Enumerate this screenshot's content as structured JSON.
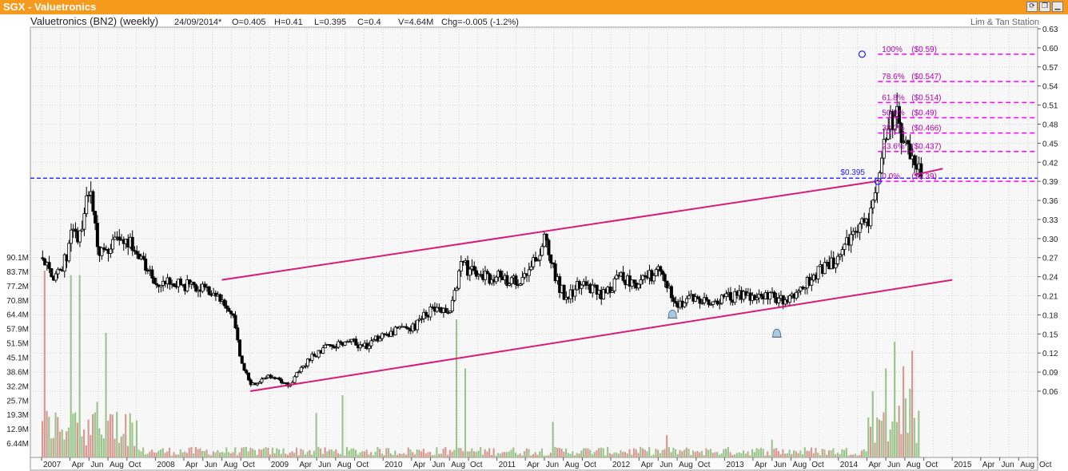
{
  "window": {
    "title": "SGX - Valuetronics",
    "buttons": [
      {
        "name": "refresh-button",
        "glyph": "⟳"
      },
      {
        "name": "restore-button",
        "glyph": "❐"
      },
      {
        "name": "minimize-button",
        "glyph": "▁"
      },
      {
        "name": "close-button",
        "glyph": "■"
      }
    ]
  },
  "header": {
    "name": "Valuetronics (BN2) (weekly)",
    "date": "24/09/2014*",
    "open": "O=0.405",
    "high": "H=0.41",
    "low": "L=0.395",
    "close": "C=0.4",
    "volume": "V=4.64M",
    "change": "Chg=-0.005 (-1.2%)",
    "source": "Lim & Tan Station"
  },
  "colors": {
    "title_bar": "#f59a1c",
    "trendline": "#d81b7a",
    "fib": "#ff00ff",
    "support_line": "#2222ee",
    "volume_up": "#9bc48a",
    "volume_down": "#d49a92",
    "grid": "#d4d4d4",
    "plot_bg": "#f7f7f7"
  },
  "chart_data": {
    "type": "candlestick",
    "title": "Valuetronics (BN2) (weekly)",
    "price_axis": {
      "side": "right",
      "ylim": [
        0.03,
        0.63
      ],
      "ticks": [
        "0.63",
        "0.60",
        "0.57",
        "0.54",
        "0.51",
        "0.48",
        "0.45",
        "0.42",
        "0.39",
        "0.36",
        "0.33",
        "0.30",
        "0.27",
        "0.24",
        "0.21",
        "0.18",
        "0.15",
        "0.12",
        "0.09",
        "0.06"
      ]
    },
    "volume_axis": {
      "side": "left",
      "ticks": [
        "90.1M",
        "83.7M",
        "77.2M",
        "70.8M",
        "64.4M",
        "57.9M",
        "51.5M",
        "45.1M",
        "38.6M",
        "32.2M",
        "25.7M",
        "19.3M",
        "12.9M",
        "6.44M"
      ]
    },
    "time_axis": {
      "labels": [
        "2007",
        "Apr",
        "Jun",
        "Aug",
        "Oct",
        "2008",
        "Apr",
        "Jun",
        "Aug",
        "Oct",
        "2009",
        "Apr",
        "Jun",
        "Aug",
        "Oct",
        "2010",
        "Apr",
        "Jun",
        "Aug",
        "Oct",
        "2011",
        "Apr",
        "Jun",
        "Aug",
        "Oct",
        "2012",
        "Apr",
        "Jun",
        "Aug",
        "Oct",
        "2013",
        "Apr",
        "Jun",
        "Aug",
        "Oct",
        "2014",
        "Apr",
        "Jun",
        "Aug",
        "Oct",
        "2015",
        "Apr",
        "Jun",
        "Aug",
        "Oct"
      ],
      "start": "2007-01",
      "end": "2015-10"
    },
    "price_path": [
      [
        "2007-01",
        0.27
      ],
      [
        "2007-02",
        0.24
      ],
      [
        "2007-03",
        0.25
      ],
      [
        "2007-04",
        0.3
      ],
      [
        "2007-05",
        0.31
      ],
      [
        "2007-06",
        0.38
      ],
      [
        "2007-07",
        0.27
      ],
      [
        "2007-08",
        0.29
      ],
      [
        "2007-09",
        0.3
      ],
      [
        "2007-10",
        0.3
      ],
      [
        "2007-11",
        0.27
      ],
      [
        "2007-12",
        0.25
      ],
      [
        "2008-01",
        0.23
      ],
      [
        "2008-03",
        0.23
      ],
      [
        "2008-06",
        0.22
      ],
      [
        "2008-08",
        0.2
      ],
      [
        "2008-09",
        0.18
      ],
      [
        "2008-10",
        0.1
      ],
      [
        "2008-11",
        0.07
      ],
      [
        "2009-01",
        0.085
      ],
      [
        "2009-03",
        0.07
      ],
      [
        "2009-05",
        0.11
      ],
      [
        "2009-07",
        0.13
      ],
      [
        "2009-09",
        0.14
      ],
      [
        "2009-11",
        0.13
      ],
      [
        "2010-01",
        0.15
      ],
      [
        "2010-04",
        0.16
      ],
      [
        "2010-06",
        0.19
      ],
      [
        "2010-08",
        0.18
      ],
      [
        "2010-09",
        0.26
      ],
      [
        "2010-11",
        0.24
      ],
      [
        "2011-01",
        0.24
      ],
      [
        "2011-03",
        0.23
      ],
      [
        "2011-05",
        0.27
      ],
      [
        "2011-06",
        0.3
      ],
      [
        "2011-07",
        0.24
      ],
      [
        "2011-08",
        0.21
      ],
      [
        "2011-10",
        0.23
      ],
      [
        "2011-12",
        0.21
      ],
      [
        "2012-02",
        0.24
      ],
      [
        "2012-04",
        0.23
      ],
      [
        "2012-06",
        0.25
      ],
      [
        "2012-07",
        0.22
      ],
      [
        "2012-08",
        0.2
      ],
      [
        "2012-10",
        0.205
      ],
      [
        "2012-12",
        0.2
      ],
      [
        "2013-02",
        0.21
      ],
      [
        "2013-05",
        0.21
      ],
      [
        "2013-07",
        0.205
      ],
      [
        "2013-09",
        0.22
      ],
      [
        "2013-11",
        0.25
      ],
      [
        "2014-01",
        0.27
      ],
      [
        "2014-02",
        0.3
      ],
      [
        "2014-04",
        0.33
      ],
      [
        "2014-05",
        0.4
      ],
      [
        "2014-06",
        0.48
      ],
      [
        "2014-07",
        0.5
      ],
      [
        "2014-08",
        0.44
      ],
      [
        "2014-09",
        0.4
      ]
    ],
    "volume_spikes_m": [
      [
        "2007-01",
        84,
        "down"
      ],
      [
        "2007-04",
        82,
        "up"
      ],
      [
        "2007-06",
        25,
        "up"
      ],
      [
        "2007-07",
        56,
        "up"
      ],
      [
        "2009-05",
        20,
        "up"
      ],
      [
        "2009-08",
        28,
        "up"
      ],
      [
        "2010-08",
        62,
        "up"
      ],
      [
        "2010-09",
        40,
        "up"
      ],
      [
        "2011-06",
        16,
        "up"
      ],
      [
        "2012-06",
        10,
        "down"
      ],
      [
        "2013-05",
        8,
        "up"
      ],
      [
        "2014-04",
        18,
        "up"
      ],
      [
        "2014-05",
        40,
        "up"
      ],
      [
        "2014-06",
        52,
        "up"
      ],
      [
        "2014-07",
        41,
        "down"
      ],
      [
        "2014-08",
        48,
        "down"
      ],
      [
        "2014-09",
        12,
        "down"
      ]
    ],
    "trendlines": [
      {
        "name": "upper-channel",
        "from": [
          "2008-08",
          0.235
        ],
        "to": [
          "2014-05",
          0.39
        ]
      },
      {
        "name": "lower-channel",
        "from": [
          "2008-11",
          0.06
        ],
        "to": [
          "2015-01",
          0.235
        ]
      },
      {
        "name": "short-trend",
        "from": [
          "2014-09",
          0.4
        ],
        "to": [
          "2014-12",
          0.41
        ]
      }
    ],
    "support": {
      "label": "$0.395",
      "value": 0.395
    },
    "fibonacci": {
      "high": 0.59,
      "low": 0.39,
      "levels": [
        {
          "label": "100%",
          "price_label": "($0.59)",
          "value": 0.59
        },
        {
          "label": "78.6%",
          "price_label": "($0.547)",
          "value": 0.547
        },
        {
          "label": "61.8%",
          "price_label": "($0.514)",
          "value": 0.514
        },
        {
          "label": "50.0%",
          "price_label": "($0.49)",
          "value": 0.49
        },
        {
          "label": "38.2%",
          "price_label": "($0.466)",
          "value": 0.466
        },
        {
          "label": "23.6%",
          "price_label": "($0.437)",
          "value": 0.437
        },
        {
          "label": "0.0%",
          "price_label": "($0.39)",
          "value": 0.39
        }
      ]
    },
    "markers": [
      {
        "name": "alert-bell-icon",
        "at": [
          "2012-07",
          0.18
        ]
      },
      {
        "name": "alert-bell-icon",
        "at": [
          "2013-06",
          0.15
        ]
      }
    ]
  }
}
